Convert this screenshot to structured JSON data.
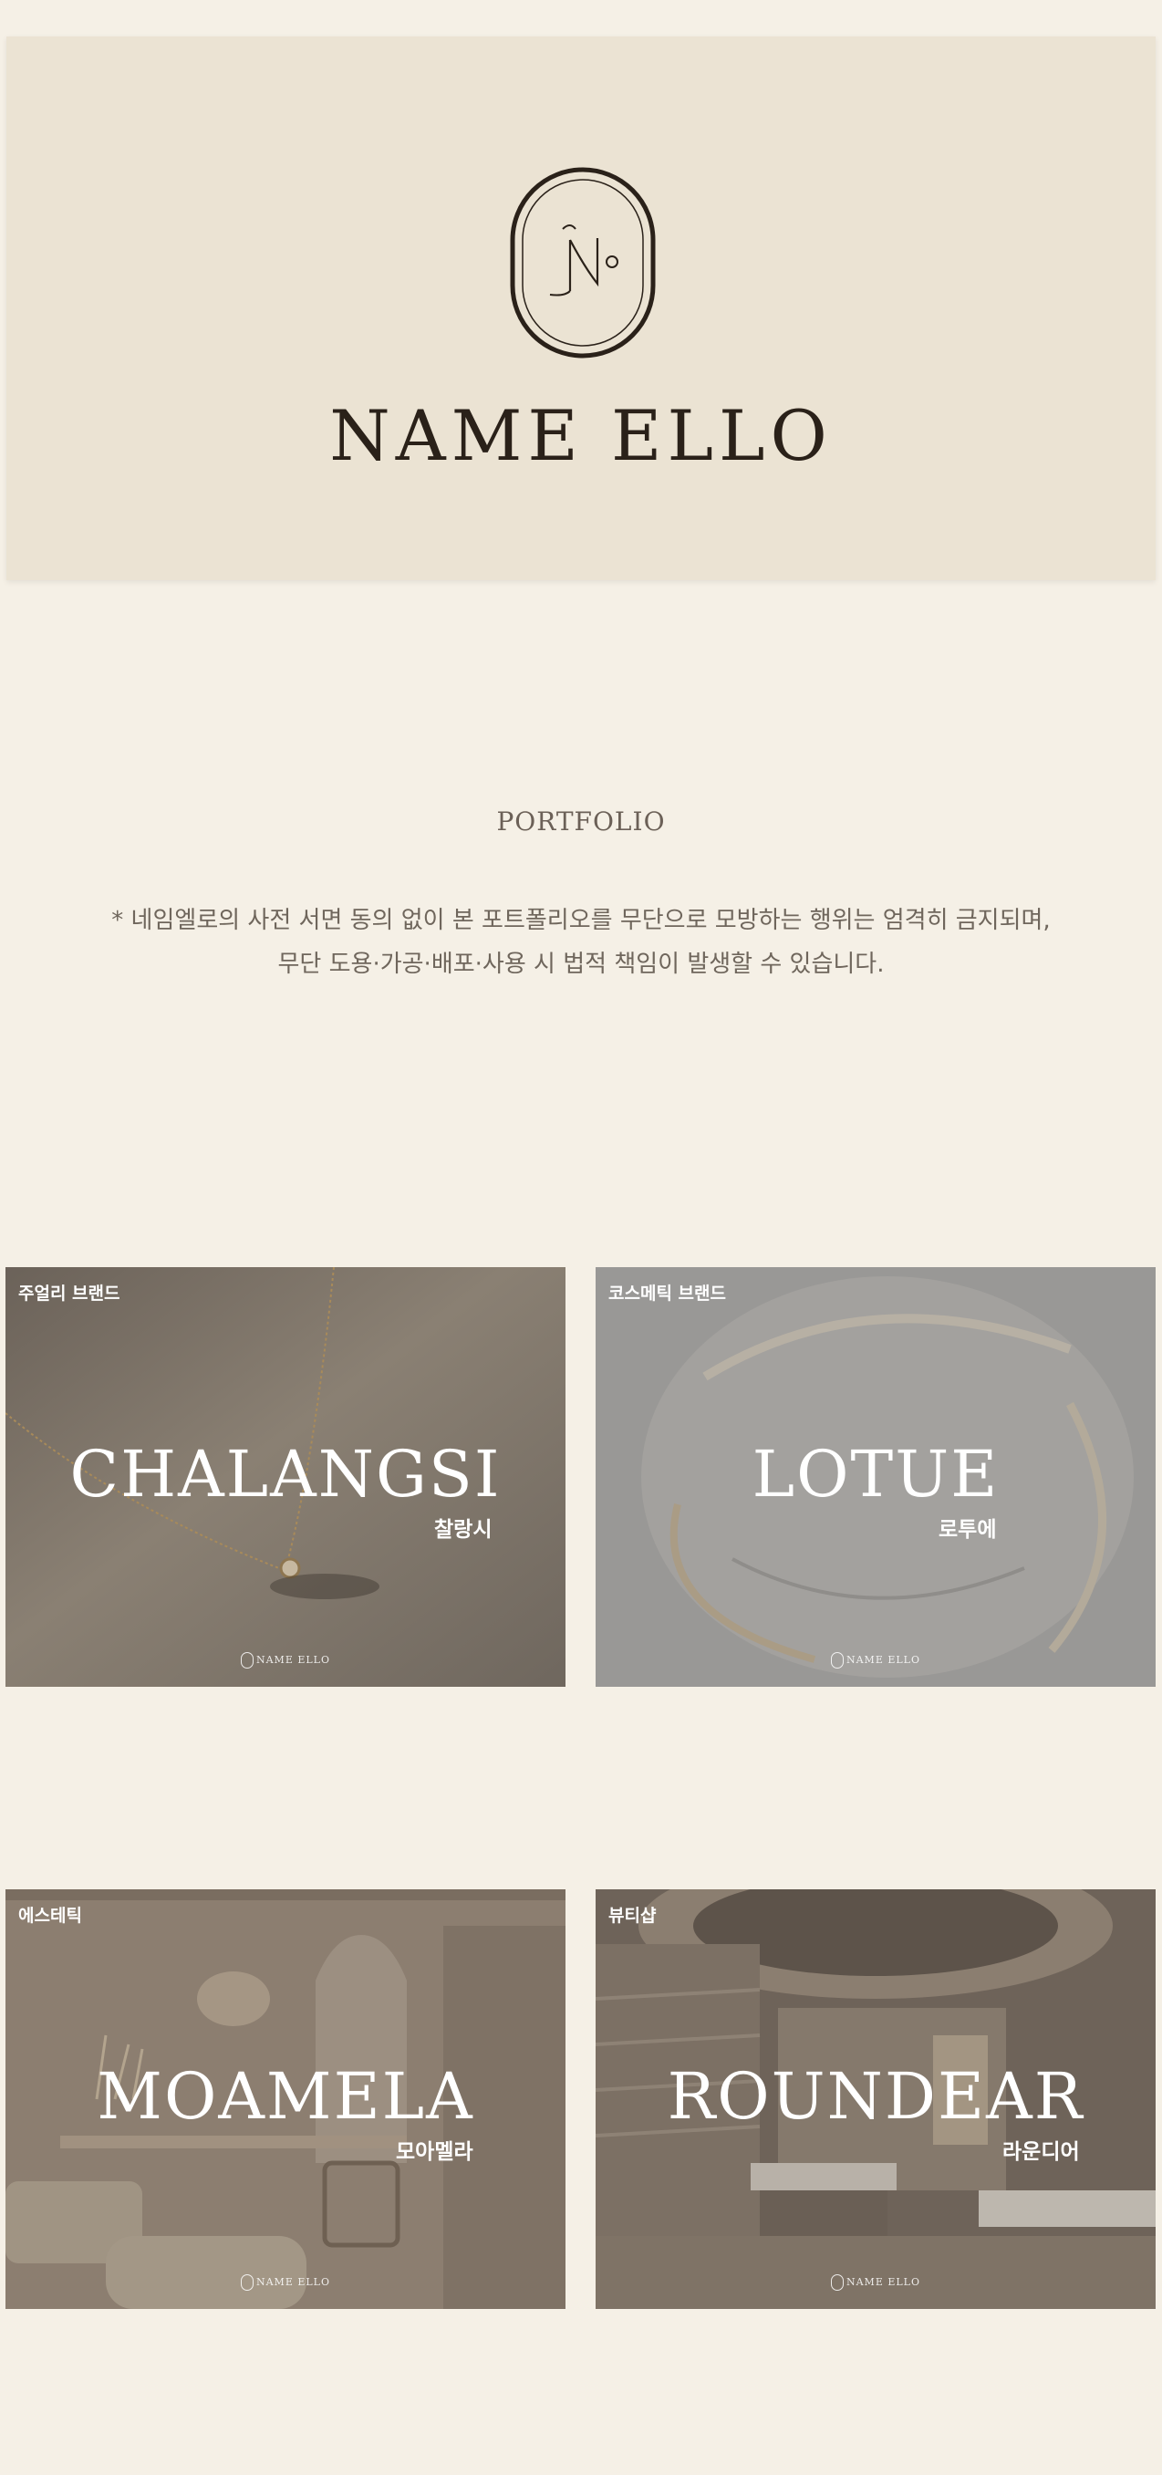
{
  "hero": {
    "brand_name": "NAME ELLO"
  },
  "portfolio": {
    "title": "PORTFOLIO",
    "notice_line1": "* 네임엘로의 사전 서면 동의 없이 본 포트폴리오를 무단으로 모방하는 행위는 엄격히 금지되며,",
    "notice_line2": "무단 도용·가공·배포·사용 시 법적 책임이 발생할 수 있습니다."
  },
  "cards": [
    {
      "tag": "주얼리 브랜드",
      "title": "CHALANGSI",
      "subtitle": "찰랑시",
      "watermark": "NAME ELLO",
      "image": "jewelry-necklace-image"
    },
    {
      "tag": "코스메틱 브랜드",
      "title": "LOTUE",
      "subtitle": "로투에",
      "watermark": "NAME ELLO",
      "image": "cream-texture-image"
    },
    {
      "tag": "에스테틱",
      "title": "MOAMELA",
      "subtitle": "모아멜라",
      "watermark": "NAME ELLO",
      "image": "aesthetic-room-image"
    },
    {
      "tag": "뷰티샵",
      "title": "ROUNDEAR",
      "subtitle": "라운디어",
      "watermark": "NAME ELLO",
      "image": "spa-room-image"
    }
  ],
  "colors": {
    "page_background": "#f5f0e6",
    "hero_background": "#ebe3d3",
    "brand_text": "#2a2119"
  }
}
